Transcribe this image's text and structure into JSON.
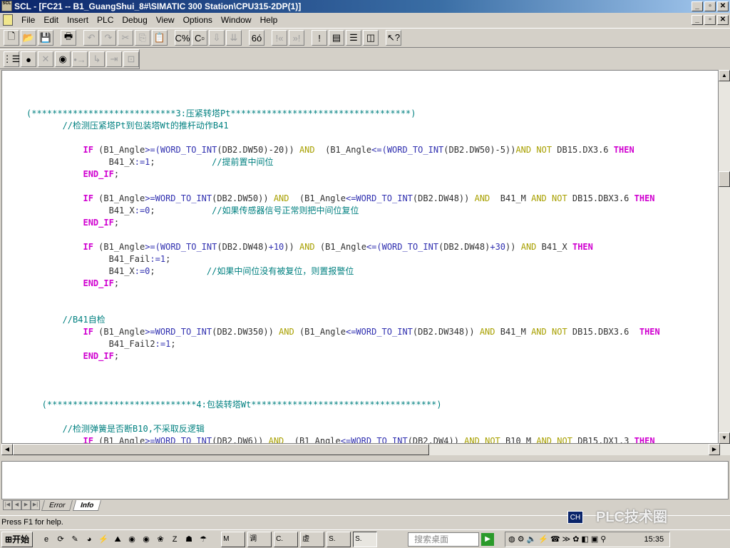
{
  "window": {
    "title": "SCL  - [FC21 -- B1_GuangShui_8#\\SIMATIC 300 Station\\CPU315-2DP(1)]",
    "app_icon_text": "SCL",
    "controls": [
      "_",
      "▫",
      "✕"
    ]
  },
  "menu": [
    "File",
    "Edit",
    "Insert",
    "PLC",
    "Debug",
    "View",
    "Options",
    "Window",
    "Help"
  ],
  "toolbar1": [
    {
      "name": "new",
      "g": "🗋",
      "d": false
    },
    {
      "name": "open",
      "g": "📂",
      "d": false
    },
    {
      "name": "save",
      "g": "💾",
      "d": false
    },
    {
      "sep": true
    },
    {
      "name": "print",
      "g": "🖶",
      "d": false
    },
    {
      "sep": true
    },
    {
      "name": "undo",
      "g": "↶",
      "d": true
    },
    {
      "name": "redo",
      "g": "↷",
      "d": true
    },
    {
      "name": "cut",
      "g": "✂",
      "d": true
    },
    {
      "name": "copy",
      "g": "⎘",
      "d": true
    },
    {
      "name": "paste",
      "g": "📋",
      "d": false
    },
    {
      "sep": true
    },
    {
      "name": "compile",
      "g": "C%",
      "d": false
    },
    {
      "name": "compile-settings",
      "g": "C▫",
      "d": false
    },
    {
      "name": "download",
      "g": "⇩",
      "d": true
    },
    {
      "name": "download-all",
      "g": "⇊",
      "d": true
    },
    {
      "sep": true
    },
    {
      "name": "monitor",
      "g": "6ó",
      "d": false
    },
    {
      "sep": true
    },
    {
      "name": "prev-error",
      "g": "!«",
      "d": true
    },
    {
      "name": "next-error",
      "g": "»!",
      "d": true
    },
    {
      "sep": true
    },
    {
      "name": "toggle-errors",
      "g": "!",
      "d": false
    },
    {
      "name": "cascade",
      "g": "▤",
      "d": false
    },
    {
      "name": "tile-horizontal",
      "g": "☰",
      "d": false
    },
    {
      "name": "tile-vertical",
      "g": "◫",
      "d": false
    },
    {
      "sep": true
    },
    {
      "name": "context-help",
      "g": "↖?",
      "d": false
    }
  ],
  "toolbar2": [
    {
      "name": "breakpoints-list",
      "g": "⋮☰",
      "d": false
    },
    {
      "name": "set-breakpoint",
      "g": "●",
      "d": false
    },
    {
      "name": "clear-breakpoints",
      "g": "✕",
      "d": true
    },
    {
      "name": "breakpoints-active",
      "g": "◉",
      "d": false
    },
    {
      "name": "step-over",
      "g": "•→",
      "d": true
    },
    {
      "name": "step-into",
      "g": "↳",
      "d": true
    },
    {
      "name": "step-out",
      "g": "⇥",
      "d": true
    },
    {
      "name": "run-to-cursor",
      "g": "⊡",
      "d": true
    }
  ],
  "code": [
    [
      [
        "c",
        "(****************************3:压紧转塔Pt***********************************)"
      ]
    ],
    [
      [
        "c",
        "       //检测压紧塔Pt到包装塔Wt的推杆动作B41"
      ]
    ],
    [],
    [
      [
        "t",
        "           "
      ],
      [
        "k",
        "IF"
      ],
      [
        "t",
        " (B1_Angle"
      ],
      [
        "f",
        ">=("
      ],
      [
        "f",
        "WORD_TO_INT"
      ],
      [
        "t",
        "(DB2.DW50)-20)) "
      ],
      [
        "o",
        "AND"
      ],
      [
        "t",
        "  (B1_Angle"
      ],
      [
        "f",
        "<=("
      ],
      [
        "f",
        "WORD_TO_INT"
      ],
      [
        "t",
        "(DB2.DW50)-5))"
      ],
      [
        "o",
        "AND"
      ],
      [
        "t",
        " "
      ],
      [
        "o",
        "NOT"
      ],
      [
        "t",
        " DB15.DX3.6 "
      ],
      [
        "k",
        "THEN"
      ]
    ],
    [
      [
        "t",
        "                B41_X"
      ],
      [
        "f",
        ":=1"
      ],
      [
        "t",
        ";           "
      ],
      [
        "c",
        "//提前置中间位"
      ]
    ],
    [
      [
        "t",
        "           "
      ],
      [
        "k",
        "END_IF"
      ],
      [
        "t",
        ";"
      ]
    ],
    [],
    [
      [
        "t",
        "           "
      ],
      [
        "k",
        "IF"
      ],
      [
        "t",
        " (B1_Angle"
      ],
      [
        "f",
        ">=WORD_TO_INT"
      ],
      [
        "t",
        "(DB2.DW50)) "
      ],
      [
        "o",
        "AND"
      ],
      [
        "t",
        "  (B1_Angle"
      ],
      [
        "f",
        "<=WORD_TO_INT"
      ],
      [
        "t",
        "(DB2.DW48)) "
      ],
      [
        "o",
        "AND"
      ],
      [
        "t",
        "  B41_M "
      ],
      [
        "o",
        "AND"
      ],
      [
        "t",
        " "
      ],
      [
        "o",
        "NOT"
      ],
      [
        "t",
        " DB15.DBX3.6 "
      ],
      [
        "k",
        "THEN"
      ]
    ],
    [
      [
        "t",
        "                B41_X"
      ],
      [
        "f",
        ":=0"
      ],
      [
        "t",
        ";           "
      ],
      [
        "c",
        "//如果传感器信号正常则把中间位复位"
      ]
    ],
    [
      [
        "t",
        "           "
      ],
      [
        "k",
        "END_IF"
      ],
      [
        "t",
        ";"
      ]
    ],
    [],
    [
      [
        "t",
        "           "
      ],
      [
        "k",
        "IF"
      ],
      [
        "t",
        " (B1_Angle"
      ],
      [
        "f",
        ">=("
      ],
      [
        "f",
        "WORD_TO_INT"
      ],
      [
        "t",
        "(DB2.DW48)"
      ],
      [
        "f",
        "+10"
      ],
      [
        "t",
        ")) "
      ],
      [
        "o",
        "AND"
      ],
      [
        "t",
        " (B1_Angle"
      ],
      [
        "f",
        "<=("
      ],
      [
        "f",
        "WORD_TO_INT"
      ],
      [
        "t",
        "(DB2.DW48)"
      ],
      [
        "f",
        "+30"
      ],
      [
        "t",
        ")) "
      ],
      [
        "o",
        "AND"
      ],
      [
        "t",
        " B41_X "
      ],
      [
        "k",
        "THEN"
      ]
    ],
    [
      [
        "t",
        "                B41_Fail"
      ],
      [
        "f",
        ":=1"
      ],
      [
        "t",
        ";"
      ]
    ],
    [
      [
        "t",
        "                B41_X"
      ],
      [
        "f",
        ":=0"
      ],
      [
        "t",
        ";          "
      ],
      [
        "c",
        "//如果中间位没有被复位，则置报警位"
      ]
    ],
    [
      [
        "t",
        "           "
      ],
      [
        "k",
        "END_IF"
      ],
      [
        "t",
        ";"
      ]
    ],
    [],
    [],
    [
      [
        "c",
        "       //B41自检"
      ]
    ],
    [
      [
        "t",
        "           "
      ],
      [
        "k",
        "IF"
      ],
      [
        "t",
        " (B1_Angle"
      ],
      [
        "f",
        ">=WORD_TO_INT"
      ],
      [
        "t",
        "(DB2.DW350)) "
      ],
      [
        "o",
        "AND"
      ],
      [
        "t",
        " (B1_Angle"
      ],
      [
        "f",
        "<=WORD_TO_INT"
      ],
      [
        "t",
        "(DB2.DW348)) "
      ],
      [
        "o",
        "AND"
      ],
      [
        "t",
        " B41_M "
      ],
      [
        "o",
        "AND"
      ],
      [
        "t",
        " "
      ],
      [
        "o",
        "NOT"
      ],
      [
        "t",
        " DB15.DBX3.6  "
      ],
      [
        "k",
        "THEN"
      ]
    ],
    [
      [
        "t",
        "                B41_Fail2"
      ],
      [
        "f",
        ":=1"
      ],
      [
        "t",
        ";"
      ]
    ],
    [
      [
        "t",
        "           "
      ],
      [
        "k",
        "END_IF"
      ],
      [
        "t",
        ";"
      ]
    ],
    [],
    [],
    [],
    [
      [
        "c",
        "   (*****************************4:包装转塔Wt************************************)"
      ]
    ],
    [],
    [
      [
        "c",
        "       //检测弹簧是否断B10,不采取反逻辑"
      ]
    ],
    [
      [
        "t",
        "           "
      ],
      [
        "k",
        "IF"
      ],
      [
        "t",
        " (B1_Angle"
      ],
      [
        "f",
        ">=WORD_TO_INT"
      ],
      [
        "t",
        "(DB2.DW6)) "
      ],
      [
        "o",
        "AND"
      ],
      [
        "t",
        "  (B1_Angle"
      ],
      [
        "f",
        "<=WORD_TO_INT"
      ],
      [
        "t",
        "(DB2.DW4)) "
      ],
      [
        "o",
        "AND"
      ],
      [
        "t",
        " "
      ],
      [
        "o",
        "NOT"
      ],
      [
        "t",
        " B10_M "
      ],
      [
        "o",
        "AND"
      ],
      [
        "t",
        " "
      ],
      [
        "o",
        "NOT"
      ],
      [
        "t",
        " DB15.DX1.3 "
      ],
      [
        "k",
        "THEN"
      ]
    ]
  ],
  "output": {
    "tabs": [
      "Error",
      "Info"
    ],
    "active_tab": "Info"
  },
  "status": {
    "text": "Press F1 for help."
  },
  "taskbar": {
    "start": "开始",
    "quicklaunch": [
      "e",
      "⟳",
      "✎",
      "◕",
      "⚡",
      "⛰",
      "◉",
      "◉",
      "❀",
      "Z",
      "☗",
      "☂"
    ],
    "tasks": [
      "M",
      "调",
      "C.",
      "虚",
      "S.",
      "S."
    ],
    "search_placeholder": "搜索桌面",
    "go": "▶",
    "tray": [
      "◍",
      "⚙",
      "🔈",
      "⚡",
      "☎",
      "≫",
      "✿",
      "◧",
      "▣",
      "⚲"
    ],
    "clock": "15:35",
    "lang": "CH"
  },
  "watermark": "PLC技术圈"
}
